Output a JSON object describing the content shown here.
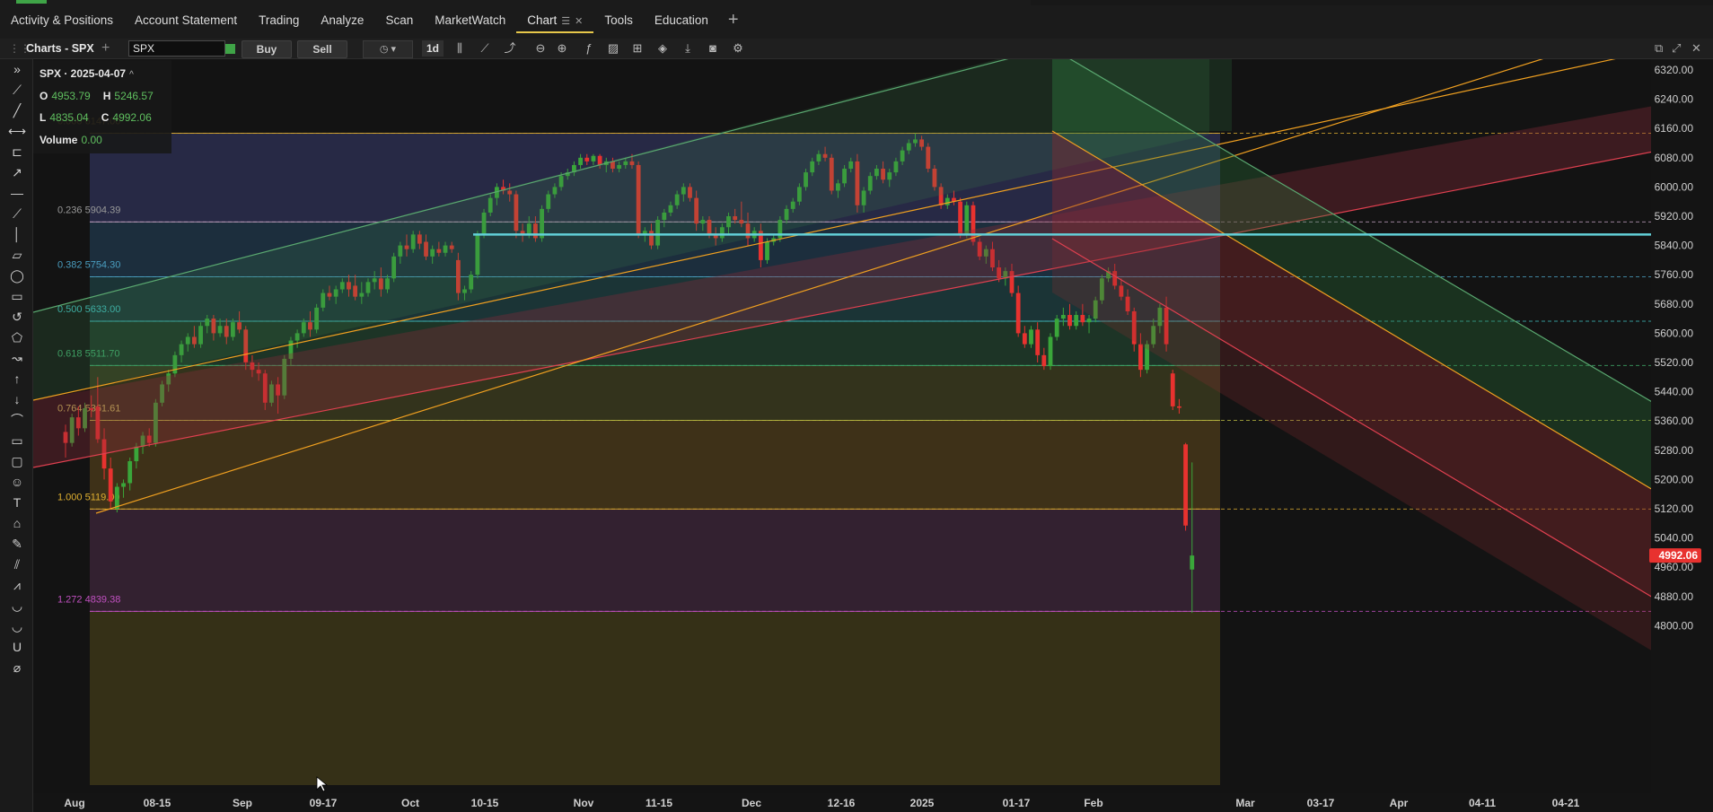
{
  "nav_tabs": [
    {
      "label": "Activity & Positions"
    },
    {
      "label": "Account Statement"
    },
    {
      "label": "Trading"
    },
    {
      "label": "Analyze"
    },
    {
      "label": "Scan"
    },
    {
      "label": "MarketWatch"
    },
    {
      "label": "Chart",
      "active": true,
      "menu_icon": "hamburger-icon",
      "close_icon": "close-icon"
    },
    {
      "label": "Tools"
    },
    {
      "label": "Education"
    }
  ],
  "add_tab_symbol": "+",
  "chart_panel": {
    "title": "Charts - SPX",
    "symbol_value": "SPX",
    "buy_label": "Buy",
    "sell_label": "Sell",
    "timeframe": "1d"
  },
  "ohlc": {
    "title": "SPX · 2025-04-07",
    "open_label": "O",
    "open": "4953.79",
    "high_label": "H",
    "high": "5246.57",
    "low_label": "L",
    "low": "4835.04",
    "close_label": "C",
    "close": "4992.06",
    "volume_label": "Volume",
    "volume": "0.00"
  },
  "colors": {
    "up": "#3aa63a",
    "down": "#e8322f",
    "teal_line": "#62d0d8",
    "orange_line": "#f0a020",
    "fib_line_gold": "#d8b040",
    "last_price_tag": "#e8322f"
  },
  "chart_data": {
    "type": "candlestick",
    "symbol": "SPX",
    "interval": "1d",
    "y_axis_ticks": [
      6320,
      6240,
      6160,
      6080,
      6000,
      5920,
      5840,
      5760,
      5680,
      5600,
      5520,
      5440,
      5360,
      5280,
      5200,
      5120,
      5040,
      4960,
      4880,
      4800
    ],
    "x_axis_labels": [
      "Aug",
      "08-15",
      "Sep",
      "09-17",
      "Oct",
      "10-15",
      "Nov",
      "11-15",
      "Dec",
      "12-16",
      "2025",
      "01-17",
      "Feb",
      "Mar",
      "03-17",
      "Apr",
      "04-11",
      "04-21"
    ],
    "last_price": "4992.06",
    "fib_levels": [
      {
        "ratio": "0.000",
        "price": "6147.00"
      },
      {
        "ratio": "0.236",
        "price": "5904.39"
      },
      {
        "ratio": "0.382",
        "price": "5754.30"
      },
      {
        "ratio": "0.500",
        "price": "5633.00"
      },
      {
        "ratio": "0.618",
        "price": "5511.70"
      },
      {
        "ratio": "0.764",
        "price": "5361.61"
      },
      {
        "ratio": "1.000",
        "price": "5119.00"
      },
      {
        "ratio": "1.272",
        "price": "4839.38"
      }
    ],
    "horizontal_line_price": 5870,
    "candles": [
      {
        "o": 5330,
        "h": 5350,
        "l": 5260,
        "c": 5300
      },
      {
        "o": 5300,
        "h": 5380,
        "l": 5290,
        "c": 5370
      },
      {
        "o": 5370,
        "h": 5400,
        "l": 5320,
        "c": 5340
      },
      {
        "o": 5340,
        "h": 5410,
        "l": 5330,
        "c": 5395
      },
      {
        "o": 5395,
        "h": 5430,
        "l": 5370,
        "c": 5390
      },
      {
        "o": 5400,
        "h": 5480,
        "l": 5300,
        "c": 5310
      },
      {
        "o": 5310,
        "h": 5340,
        "l": 5200,
        "c": 5230
      },
      {
        "o": 5230,
        "h": 5260,
        "l": 5120,
        "c": 5140
      },
      {
        "o": 5120,
        "h": 5190,
        "l": 5110,
        "c": 5180
      },
      {
        "o": 5180,
        "h": 5200,
        "l": 5150,
        "c": 5190
      },
      {
        "o": 5190,
        "h": 5260,
        "l": 5170,
        "c": 5250
      },
      {
        "o": 5250,
        "h": 5300,
        "l": 5230,
        "c": 5290
      },
      {
        "o": 5290,
        "h": 5330,
        "l": 5270,
        "c": 5320
      },
      {
        "o": 5320,
        "h": 5340,
        "l": 5290,
        "c": 5300
      },
      {
        "o": 5300,
        "h": 5420,
        "l": 5290,
        "c": 5410
      },
      {
        "o": 5410,
        "h": 5470,
        "l": 5400,
        "c": 5460
      },
      {
        "o": 5460,
        "h": 5500,
        "l": 5440,
        "c": 5490
      },
      {
        "o": 5490,
        "h": 5550,
        "l": 5480,
        "c": 5540
      },
      {
        "o": 5540,
        "h": 5580,
        "l": 5520,
        "c": 5570
      },
      {
        "o": 5570,
        "h": 5600,
        "l": 5550,
        "c": 5590
      },
      {
        "o": 5590,
        "h": 5620,
        "l": 5560,
        "c": 5570
      },
      {
        "o": 5570,
        "h": 5630,
        "l": 5560,
        "c": 5620
      },
      {
        "o": 5620,
        "h": 5650,
        "l": 5600,
        "c": 5640
      },
      {
        "o": 5640,
        "h": 5650,
        "l": 5580,
        "c": 5600
      },
      {
        "o": 5600,
        "h": 5640,
        "l": 5590,
        "c": 5620
      },
      {
        "o": 5620,
        "h": 5640,
        "l": 5570,
        "c": 5590
      },
      {
        "o": 5590,
        "h": 5640,
        "l": 5580,
        "c": 5630
      },
      {
        "o": 5630,
        "h": 5660,
        "l": 5600,
        "c": 5610
      },
      {
        "o": 5610,
        "h": 5620,
        "l": 5500,
        "c": 5520
      },
      {
        "o": 5520,
        "h": 5540,
        "l": 5480,
        "c": 5500
      },
      {
        "o": 5500,
        "h": 5520,
        "l": 5470,
        "c": 5490
      },
      {
        "o": 5490,
        "h": 5500,
        "l": 5390,
        "c": 5410
      },
      {
        "o": 5410,
        "h": 5470,
        "l": 5400,
        "c": 5460
      },
      {
        "o": 5460,
        "h": 5480,
        "l": 5380,
        "c": 5430
      },
      {
        "o": 5430,
        "h": 5540,
        "l": 5420,
        "c": 5530
      },
      {
        "o": 5530,
        "h": 5590,
        "l": 5510,
        "c": 5580
      },
      {
        "o": 5580,
        "h": 5610,
        "l": 5560,
        "c": 5600
      },
      {
        "o": 5600,
        "h": 5640,
        "l": 5590,
        "c": 5630
      },
      {
        "o": 5630,
        "h": 5660,
        "l": 5590,
        "c": 5610
      },
      {
        "o": 5610,
        "h": 5680,
        "l": 5600,
        "c": 5670
      },
      {
        "o": 5670,
        "h": 5720,
        "l": 5660,
        "c": 5710
      },
      {
        "o": 5710,
        "h": 5730,
        "l": 5690,
        "c": 5700
      },
      {
        "o": 5700,
        "h": 5730,
        "l": 5680,
        "c": 5720
      },
      {
        "o": 5720,
        "h": 5750,
        "l": 5710,
        "c": 5740
      },
      {
        "o": 5740,
        "h": 5760,
        "l": 5700,
        "c": 5720
      },
      {
        "o": 5730,
        "h": 5760,
        "l": 5690,
        "c": 5700
      },
      {
        "o": 5700,
        "h": 5740,
        "l": 5680,
        "c": 5710
      },
      {
        "o": 5710,
        "h": 5750,
        "l": 5700,
        "c": 5740
      },
      {
        "o": 5740,
        "h": 5770,
        "l": 5720,
        "c": 5750
      },
      {
        "o": 5750,
        "h": 5780,
        "l": 5700,
        "c": 5720
      },
      {
        "o": 5720,
        "h": 5760,
        "l": 5710,
        "c": 5750
      },
      {
        "o": 5750,
        "h": 5820,
        "l": 5740,
        "c": 5810
      },
      {
        "o": 5810,
        "h": 5850,
        "l": 5790,
        "c": 5840
      },
      {
        "o": 5840,
        "h": 5870,
        "l": 5810,
        "c": 5830
      },
      {
        "o": 5830,
        "h": 5880,
        "l": 5820,
        "c": 5870
      },
      {
        "o": 5870,
        "h": 5880,
        "l": 5830,
        "c": 5845
      },
      {
        "o": 5850,
        "h": 5870,
        "l": 5800,
        "c": 5810
      },
      {
        "o": 5810,
        "h": 5840,
        "l": 5790,
        "c": 5830
      },
      {
        "o": 5830,
        "h": 5850,
        "l": 5810,
        "c": 5820
      },
      {
        "o": 5820,
        "h": 5850,
        "l": 5810,
        "c": 5840
      },
      {
        "o": 5840,
        "h": 5850,
        "l": 5820,
        "c": 5830
      },
      {
        "o": 5800,
        "h": 5820,
        "l": 5690,
        "c": 5710
      },
      {
        "o": 5710,
        "h": 5730,
        "l": 5690,
        "c": 5720
      },
      {
        "o": 5720,
        "h": 5770,
        "l": 5710,
        "c": 5760
      },
      {
        "o": 5760,
        "h": 5880,
        "l": 5750,
        "c": 5870
      },
      {
        "o": 5870,
        "h": 5940,
        "l": 5860,
        "c": 5930
      },
      {
        "o": 5930,
        "h": 5980,
        "l": 5920,
        "c": 5970
      },
      {
        "o": 5970,
        "h": 6010,
        "l": 5950,
        "c": 6000
      },
      {
        "o": 6000,
        "h": 6020,
        "l": 5980,
        "c": 5990
      },
      {
        "o": 5990,
        "h": 6010,
        "l": 5960,
        "c": 5980
      },
      {
        "o": 5980,
        "h": 5990,
        "l": 5860,
        "c": 5880
      },
      {
        "o": 5880,
        "h": 5900,
        "l": 5850,
        "c": 5870
      },
      {
        "o": 5870,
        "h": 5920,
        "l": 5860,
        "c": 5900
      },
      {
        "o": 5900,
        "h": 5920,
        "l": 5850,
        "c": 5860
      },
      {
        "o": 5860,
        "h": 5950,
        "l": 5850,
        "c": 5940
      },
      {
        "o": 5940,
        "h": 5990,
        "l": 5930,
        "c": 5980
      },
      {
        "o": 5980,
        "h": 6010,
        "l": 5970,
        "c": 6000
      },
      {
        "o": 6000,
        "h": 6040,
        "l": 5990,
        "c": 6030
      },
      {
        "o": 6030,
        "h": 6050,
        "l": 6020,
        "c": 6040
      },
      {
        "o": 6040,
        "h": 6070,
        "l": 6030,
        "c": 6060
      },
      {
        "o": 6060,
        "h": 6090,
        "l": 6050,
        "c": 6080
      },
      {
        "o": 6080,
        "h": 6090,
        "l": 6060,
        "c": 6070
      },
      {
        "o": 6070,
        "h": 6090,
        "l": 6060,
        "c": 6085
      },
      {
        "o": 6085,
        "h": 6090,
        "l": 6050,
        "c": 6060
      },
      {
        "o": 6060,
        "h": 6080,
        "l": 6040,
        "c": 6070
      },
      {
        "o": 6070,
        "h": 6080,
        "l": 6040,
        "c": 6050
      },
      {
        "o": 6050,
        "h": 6070,
        "l": 6040,
        "c": 6060
      },
      {
        "o": 6060,
        "h": 6080,
        "l": 6050,
        "c": 6070
      },
      {
        "o": 6070,
        "h": 6090,
        "l": 6050,
        "c": 6060
      },
      {
        "o": 6060,
        "h": 6070,
        "l": 5860,
        "c": 5870
      },
      {
        "o": 5870,
        "h": 5890,
        "l": 5850,
        "c": 5880
      },
      {
        "o": 5880,
        "h": 5900,
        "l": 5830,
        "c": 5840
      },
      {
        "o": 5840,
        "h": 5920,
        "l": 5830,
        "c": 5910
      },
      {
        "o": 5910,
        "h": 5940,
        "l": 5890,
        "c": 5930
      },
      {
        "o": 5930,
        "h": 5960,
        "l": 5920,
        "c": 5950
      },
      {
        "o": 5950,
        "h": 5990,
        "l": 5940,
        "c": 5980
      },
      {
        "o": 5980,
        "h": 6010,
        "l": 5960,
        "c": 6000
      },
      {
        "o": 6000,
        "h": 6010,
        "l": 5960,
        "c": 5970
      },
      {
        "o": 5970,
        "h": 5990,
        "l": 5880,
        "c": 5900
      },
      {
        "o": 5900,
        "h": 5920,
        "l": 5880,
        "c": 5910
      },
      {
        "o": 5910,
        "h": 5920,
        "l": 5860,
        "c": 5870
      },
      {
        "o": 5870,
        "h": 5890,
        "l": 5840,
        "c": 5860
      },
      {
        "o": 5860,
        "h": 5900,
        "l": 5850,
        "c": 5890
      },
      {
        "o": 5890,
        "h": 5930,
        "l": 5870,
        "c": 5920
      },
      {
        "o": 5920,
        "h": 5940,
        "l": 5900,
        "c": 5910
      },
      {
        "o": 5910,
        "h": 5960,
        "l": 5890,
        "c": 5900
      },
      {
        "o": 5900,
        "h": 5930,
        "l": 5840,
        "c": 5860
      },
      {
        "o": 5860,
        "h": 5890,
        "l": 5850,
        "c": 5880
      },
      {
        "o": 5880,
        "h": 5900,
        "l": 5780,
        "c": 5800
      },
      {
        "o": 5800,
        "h": 5860,
        "l": 5790,
        "c": 5850
      },
      {
        "o": 5850,
        "h": 5870,
        "l": 5840,
        "c": 5860
      },
      {
        "o": 5860,
        "h": 5920,
        "l": 5850,
        "c": 5910
      },
      {
        "o": 5910,
        "h": 5950,
        "l": 5900,
        "c": 5940
      },
      {
        "o": 5940,
        "h": 5970,
        "l": 5930,
        "c": 5960
      },
      {
        "o": 5960,
        "h": 6010,
        "l": 5950,
        "c": 6000
      },
      {
        "o": 6000,
        "h": 6050,
        "l": 5990,
        "c": 6040
      },
      {
        "o": 6040,
        "h": 6080,
        "l": 6030,
        "c": 6070
      },
      {
        "o": 6070,
        "h": 6100,
        "l": 6060,
        "c": 6090
      },
      {
        "o": 6090,
        "h": 6110,
        "l": 6070,
        "c": 6080
      },
      {
        "o": 6080,
        "h": 6090,
        "l": 5980,
        "c": 5990
      },
      {
        "o": 5990,
        "h": 6020,
        "l": 5970,
        "c": 6010
      },
      {
        "o": 6010,
        "h": 6060,
        "l": 6000,
        "c": 6050
      },
      {
        "o": 6050,
        "h": 6080,
        "l": 6040,
        "c": 6070
      },
      {
        "o": 6070,
        "h": 6090,
        "l": 5930,
        "c": 5950
      },
      {
        "o": 5950,
        "h": 6000,
        "l": 5930,
        "c": 5990
      },
      {
        "o": 5990,
        "h": 6040,
        "l": 5980,
        "c": 6030
      },
      {
        "o": 6030,
        "h": 6060,
        "l": 6020,
        "c": 6050
      },
      {
        "o": 6050,
        "h": 6070,
        "l": 6010,
        "c": 6020
      },
      {
        "o": 6020,
        "h": 6050,
        "l": 6000,
        "c": 6040
      },
      {
        "o": 6040,
        "h": 6080,
        "l": 6030,
        "c": 6070
      },
      {
        "o": 6070,
        "h": 6110,
        "l": 6060,
        "c": 6100
      },
      {
        "o": 6100,
        "h": 6130,
        "l": 6090,
        "c": 6120
      },
      {
        "o": 6120,
        "h": 6147,
        "l": 6110,
        "c": 6130
      },
      {
        "o": 6130,
        "h": 6140,
        "l": 6100,
        "c": 6110
      },
      {
        "o": 6110,
        "h": 6120,
        "l": 6040,
        "c": 6050
      },
      {
        "o": 6050,
        "h": 6060,
        "l": 5990,
        "c": 6000
      },
      {
        "o": 6000,
        "h": 6010,
        "l": 5940,
        "c": 5950
      },
      {
        "o": 5950,
        "h": 5980,
        "l": 5940,
        "c": 5970
      },
      {
        "o": 5970,
        "h": 5990,
        "l": 5950,
        "c": 5960
      },
      {
        "o": 5960,
        "h": 5970,
        "l": 5860,
        "c": 5870
      },
      {
        "o": 5870,
        "h": 5960,
        "l": 5860,
        "c": 5950
      },
      {
        "o": 5950,
        "h": 5960,
        "l": 5840,
        "c": 5850
      },
      {
        "o": 5850,
        "h": 5860,
        "l": 5800,
        "c": 5810
      },
      {
        "o": 5810,
        "h": 5840,
        "l": 5790,
        "c": 5830
      },
      {
        "o": 5830,
        "h": 5850,
        "l": 5770,
        "c": 5780
      },
      {
        "o": 5780,
        "h": 5800,
        "l": 5740,
        "c": 5750
      },
      {
        "o": 5750,
        "h": 5780,
        "l": 5730,
        "c": 5770
      },
      {
        "o": 5770,
        "h": 5790,
        "l": 5700,
        "c": 5710
      },
      {
        "o": 5710,
        "h": 5730,
        "l": 5590,
        "c": 5600
      },
      {
        "o": 5600,
        "h": 5620,
        "l": 5560,
        "c": 5570
      },
      {
        "o": 5570,
        "h": 5620,
        "l": 5560,
        "c": 5610
      },
      {
        "o": 5610,
        "h": 5630,
        "l": 5520,
        "c": 5540
      },
      {
        "o": 5540,
        "h": 5560,
        "l": 5500,
        "c": 5510
      },
      {
        "o": 5510,
        "h": 5600,
        "l": 5500,
        "c": 5590
      },
      {
        "o": 5590,
        "h": 5650,
        "l": 5580,
        "c": 5640
      },
      {
        "o": 5640,
        "h": 5670,
        "l": 5620,
        "c": 5650
      },
      {
        "o": 5650,
        "h": 5680,
        "l": 5610,
        "c": 5620
      },
      {
        "o": 5620,
        "h": 5660,
        "l": 5610,
        "c": 5650
      },
      {
        "o": 5650,
        "h": 5680,
        "l": 5620,
        "c": 5630
      },
      {
        "o": 5630,
        "h": 5650,
        "l": 5600,
        "c": 5640
      },
      {
        "o": 5640,
        "h": 5700,
        "l": 5630,
        "c": 5690
      },
      {
        "o": 5690,
        "h": 5760,
        "l": 5680,
        "c": 5750
      },
      {
        "o": 5750,
        "h": 5780,
        "l": 5740,
        "c": 5770
      },
      {
        "o": 5770,
        "h": 5790,
        "l": 5720,
        "c": 5730
      },
      {
        "o": 5730,
        "h": 5750,
        "l": 5690,
        "c": 5700
      },
      {
        "o": 5700,
        "h": 5720,
        "l": 5650,
        "c": 5660
      },
      {
        "o": 5660,
        "h": 5670,
        "l": 5550,
        "c": 5570
      },
      {
        "o": 5570,
        "h": 5600,
        "l": 5480,
        "c": 5500
      },
      {
        "o": 5500,
        "h": 5580,
        "l": 5490,
        "c": 5570
      },
      {
        "o": 5570,
        "h": 5640,
        "l": 5560,
        "c": 5620
      },
      {
        "o": 5620,
        "h": 5680,
        "l": 5600,
        "c": 5670
      },
      {
        "o": 5670,
        "h": 5700,
        "l": 5550,
        "c": 5570
      },
      {
        "o": 5490,
        "h": 5500,
        "l": 5390,
        "c": 5400
      },
      {
        "o": 5400,
        "h": 5420,
        "l": 5380,
        "c": 5396
      },
      {
        "o": 5296,
        "h": 5300,
        "l": 5060,
        "c": 5074
      },
      {
        "o": 4953.79,
        "h": 5246.57,
        "l": 4835.04,
        "c": 4992.06
      }
    ]
  }
}
